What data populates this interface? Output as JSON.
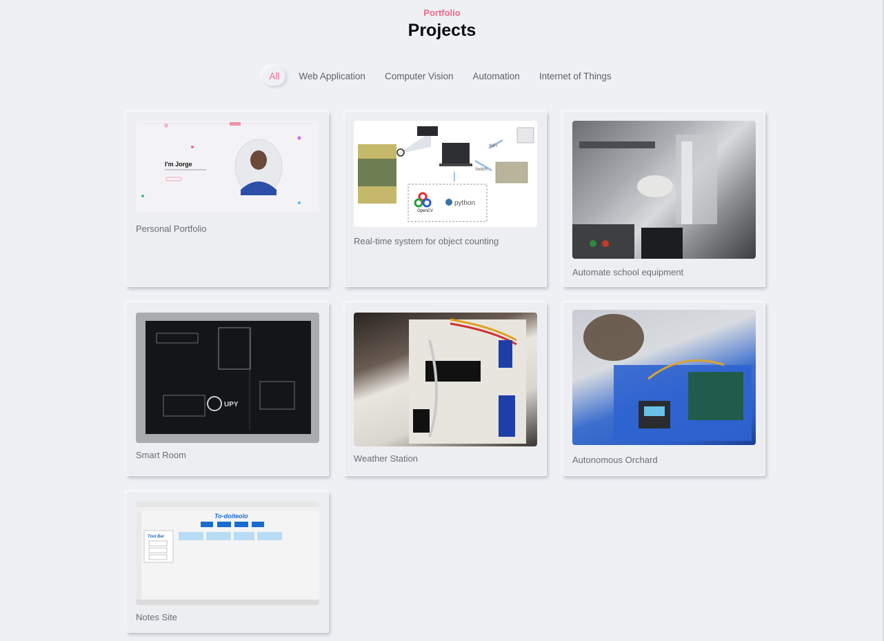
{
  "header": {
    "eyebrow": "Portfolio",
    "title": "Projects"
  },
  "filters": [
    {
      "label": "All",
      "active": true
    },
    {
      "label": "Web Application",
      "active": false
    },
    {
      "label": "Computer Vision",
      "active": false
    },
    {
      "label": "Automation",
      "active": false
    },
    {
      "label": "Internet of Things",
      "active": false
    }
  ],
  "projects": [
    {
      "label": "Personal Portfolio",
      "image": "portfolio-screenshot",
      "hero_name": "I'm Jorge",
      "hero_subtitle": "JavaScript Specialist · Software Engineer",
      "avatar": "user-photo"
    },
    {
      "label": "Real-time system for object counting",
      "image": "object-counting-diagram",
      "logos": [
        "OpenCV",
        "python"
      ],
      "arrow_labels": [
        "WiFi",
        "Switch"
      ]
    },
    {
      "label": "Automate school equipment",
      "image": "industrial-automation-photo"
    },
    {
      "label": "Smart Room",
      "image": "pcb-photo",
      "board_text": "UPY"
    },
    {
      "label": "Weather Station",
      "image": "breadboard-photo"
    },
    {
      "label": "Autonomous Orchard",
      "image": "iot-board-photo"
    },
    {
      "label": "Notes Site",
      "image": "todo-app-screenshot",
      "app_title": "To-doiteolo",
      "toolbar_title": "Tool Bar"
    }
  ],
  "colors": {
    "accent": "#ec6b8c",
    "background": "#eef0f4",
    "text_muted": "#6a6d74"
  }
}
